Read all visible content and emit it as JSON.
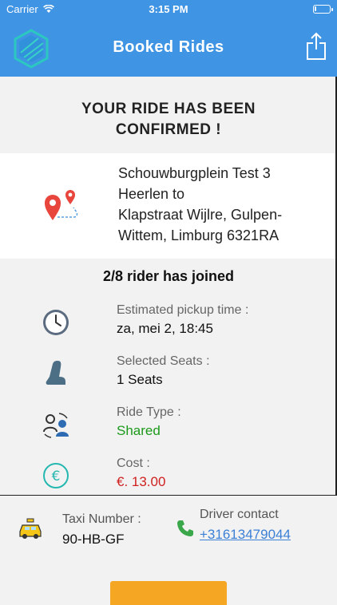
{
  "status_bar": {
    "carrier": "Carrier",
    "time": "3:15 PM",
    "battery_level": 0.1
  },
  "header": {
    "title": "Booked Rides",
    "logo_icon": "hexagon-logo-icon",
    "share_icon": "share-icon",
    "background": "#3f94e3"
  },
  "confirmation": {
    "line1": "YOUR RIDE HAS BEEN",
    "line2": "CONFIRMED !"
  },
  "route": {
    "icon": "route-pins-icon",
    "lines": [
      "Schouwburgplein Test 3",
      "Heerlen to",
      "Klapstraat Wijlre, Gulpen-",
      "Wittem, Limburg 6321RA"
    ]
  },
  "riders": "2/8 rider has joined",
  "details": [
    {
      "icon": "clock-icon",
      "label": "Estimated pickup time :",
      "value": "za, mei 2, 18:45",
      "color": "#111111"
    },
    {
      "icon": "seat-icon",
      "label": "Selected Seats :",
      "value": "1 Seats",
      "color": "#111111"
    },
    {
      "icon": "ride-share-icon",
      "label": "Ride Type :",
      "value": "Shared",
      "color": "#1b9a1b"
    },
    {
      "icon": "euro-icon",
      "label": "Cost :",
      "value": "€. 13.00",
      "color": "#d02020"
    }
  ],
  "taxi": {
    "label": "Taxi Number :",
    "value": "90-HB-GF",
    "icon": "taxi-icon"
  },
  "driver": {
    "label": "Driver contact",
    "value": "+31613479044",
    "icon": "phone-icon"
  },
  "bottom_button": {
    "label": "",
    "color": "#f5a623"
  }
}
